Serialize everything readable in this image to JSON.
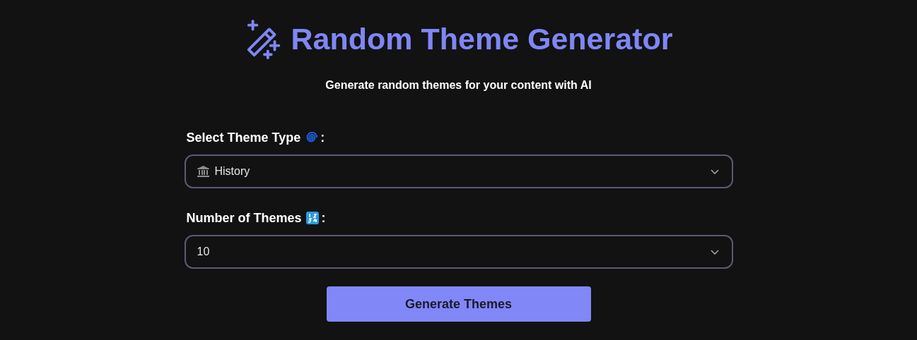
{
  "header": {
    "title": "Random Theme Generator",
    "subtitle": "Generate random themes for your content with AI"
  },
  "fields": [
    {
      "label": "Select Theme Type",
      "label_icon": {
        "kind": "spiral"
      },
      "separator": ":",
      "value": "History",
      "value_icon": {
        "kind": "building"
      }
    },
    {
      "label": "Number of Themes",
      "label_icon": {
        "kind": "numbers"
      },
      "separator": ":",
      "value": "10"
    }
  ],
  "button": {
    "label": "Generate Themes"
  }
}
